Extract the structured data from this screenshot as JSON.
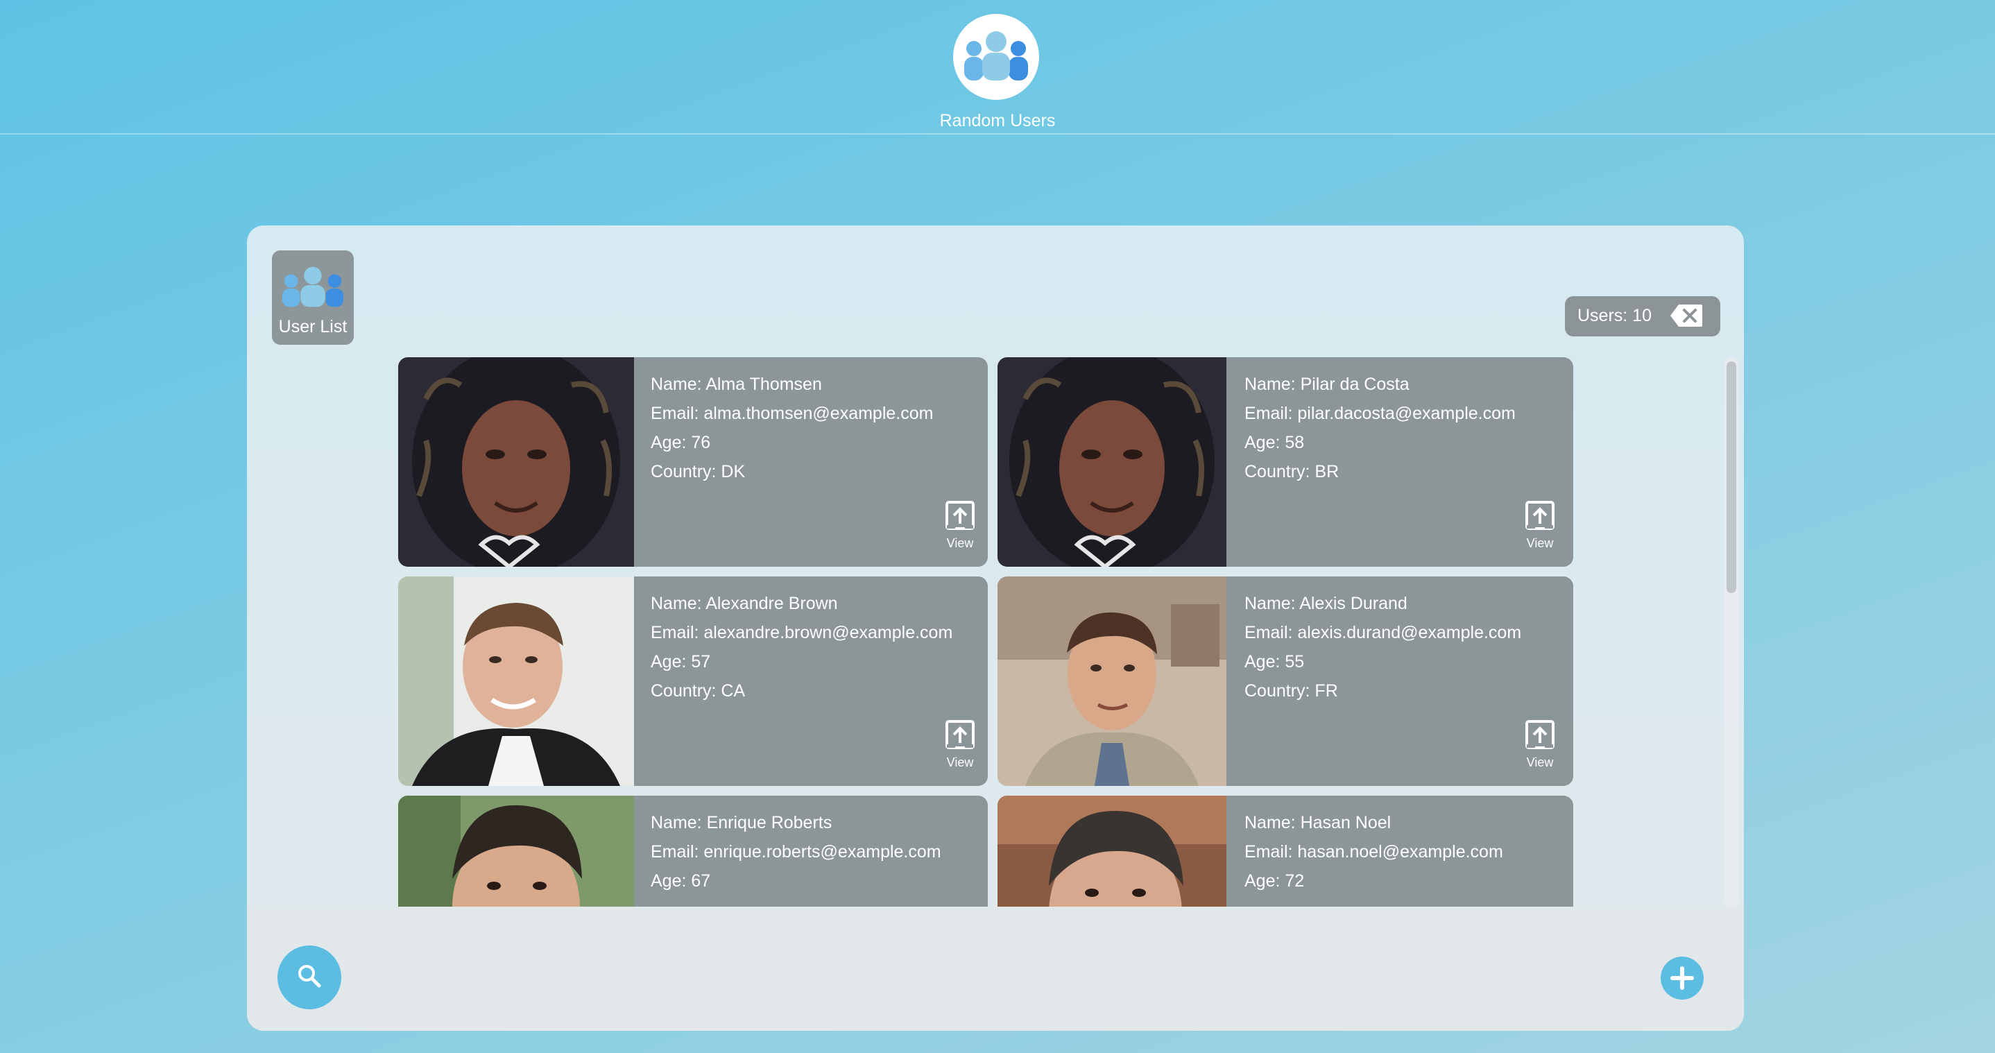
{
  "app": {
    "title": "Random Users"
  },
  "panel": {
    "list_label": "User List",
    "users_count_label": "Users: 10"
  },
  "cards": [
    {
      "name": "Name: Alma Thomsen",
      "email": "Email: alma.thomsen@example.com",
      "age": "Age: 76",
      "country": "Country: DK",
      "view_label": "View"
    },
    {
      "name": "Name: Pilar da Costa",
      "email": "Email: pilar.dacosta@example.com",
      "age": "Age: 58",
      "country": "Country: BR",
      "view_label": "View"
    },
    {
      "name": "Name: Alexandre Brown",
      "email": "Email: alexandre.brown@example.com",
      "age": "Age: 57",
      "country": "Country: CA",
      "view_label": "View"
    },
    {
      "name": "Name: Alexis Durand",
      "email": "Email: alexis.durand@example.com",
      "age": "Age: 55",
      "country": "Country: FR",
      "view_label": "View"
    },
    {
      "name": "Name: Enrique Roberts",
      "email": "Email: enrique.roberts@example.com",
      "age": "Age: 67"
    },
    {
      "name": "Name: Hasan Noel",
      "email": "Email: hasan.noel@example.com",
      "age": "Age: 72"
    }
  ],
  "icons": {
    "app_logo": "users-group-icon",
    "list": "users-group-icon",
    "clear": "backspace-icon",
    "view": "open-external-icon",
    "search": "search-icon",
    "add": "plus-icon"
  },
  "colors": {
    "accent": "#5bbde2",
    "card_bg": "#8c9598",
    "panel_bg": "#dde9ee"
  }
}
